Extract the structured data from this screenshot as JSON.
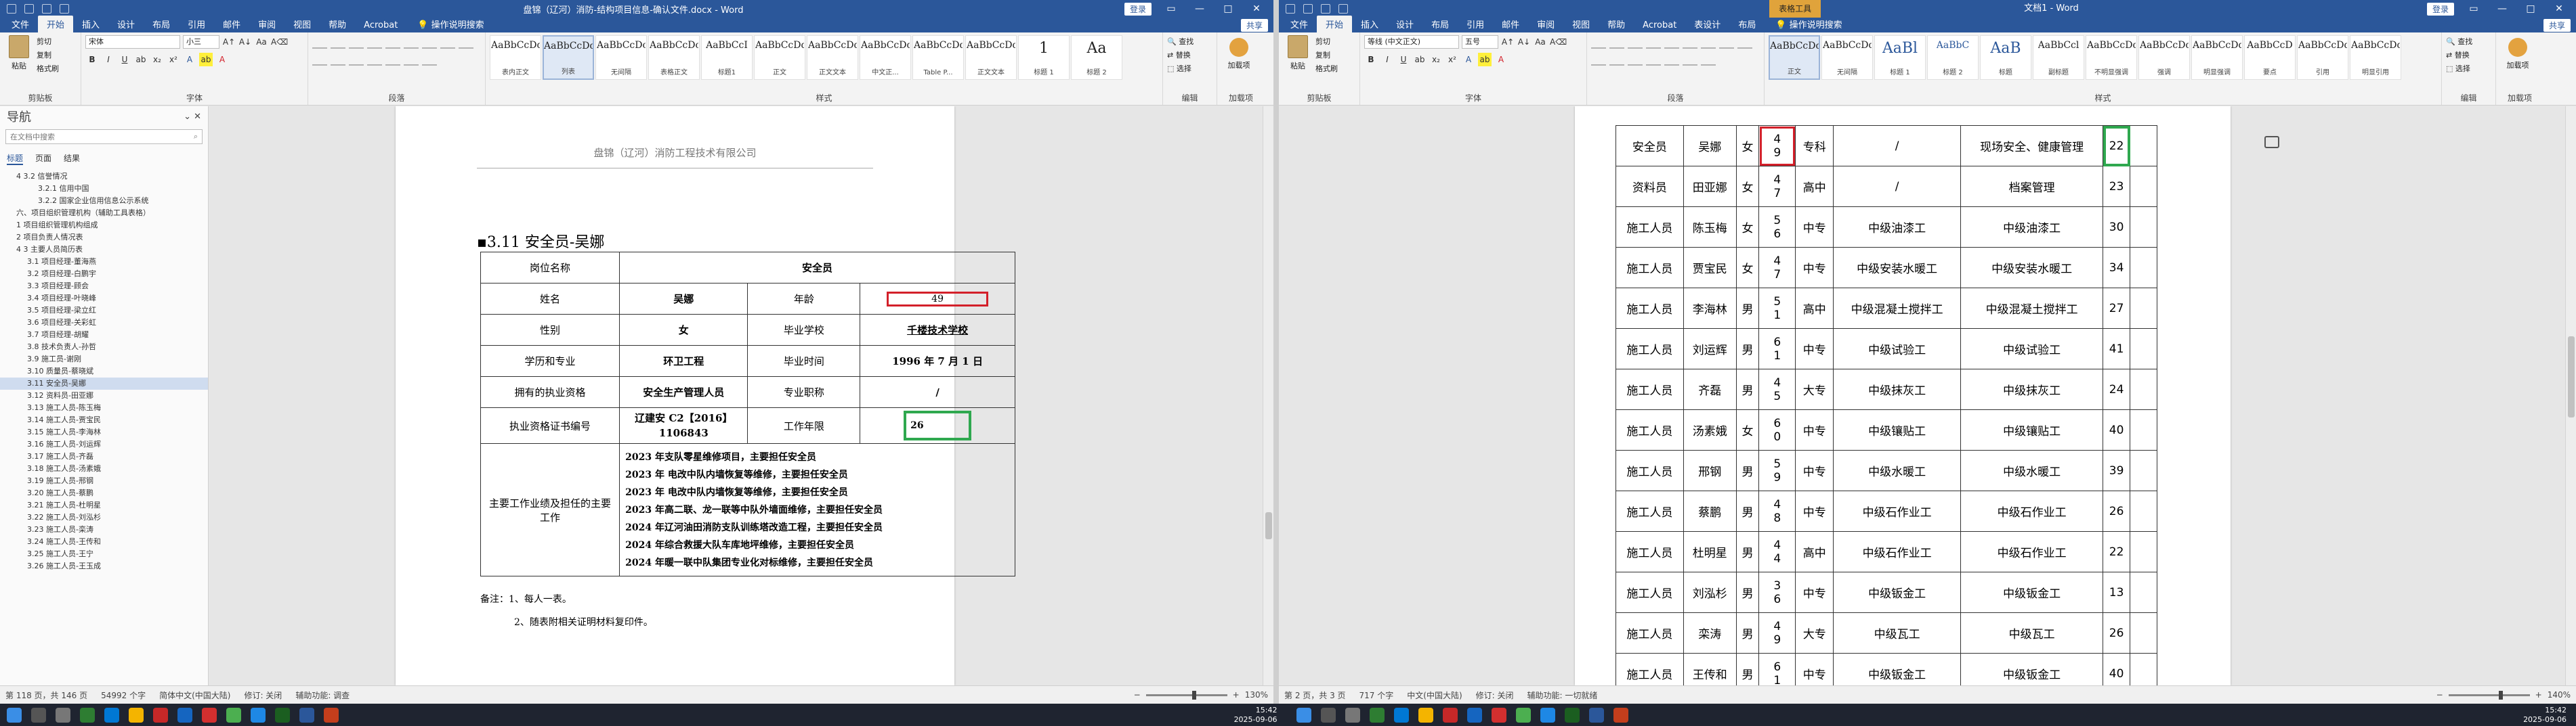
{
  "left": {
    "title": "盘锦（辽河）消防-结构项目信息-确认文件.docx - Word",
    "signin": "登录",
    "share": "共享",
    "tabs": [
      "文件",
      "开始",
      "插入",
      "设计",
      "布局",
      "引用",
      "邮件",
      "审阅",
      "视图",
      "帮助",
      "Acrobat"
    ],
    "tell_me": "操作说明搜索",
    "clipboard": {
      "paste": "粘贴",
      "cut": "剪切",
      "copy": "复制",
      "painter": "格式刷",
      "label": "剪贴板"
    },
    "font": {
      "name": "宋体",
      "size": "小三",
      "label": "字体"
    },
    "paragraph_label": "段落",
    "styles": [
      {
        "sample": "AaBbCcDd",
        "name": "表内正文"
      },
      {
        "sample": "AaBbCcDd",
        "name": "列表"
      },
      {
        "sample": "AaBbCcDc",
        "name": "无间隔"
      },
      {
        "sample": "AaBbCcDc",
        "name": "表格正文"
      },
      {
        "sample": "AaBbCcI",
        "name": "标题1"
      },
      {
        "sample": "AaBbCcDd",
        "name": "正文"
      },
      {
        "sample": "AaBbCcDd",
        "name": "正文文本"
      },
      {
        "sample": "AaBbCcDd",
        "name": "中文正..."
      },
      {
        "sample": "AaBbCcDd",
        "name": "Table P..."
      },
      {
        "sample": "AaBbCcDd",
        "name": "正文文本"
      },
      {
        "sample": "1",
        "name": "标题 1"
      },
      {
        "sample": "Aa",
        "name": "标题 2"
      }
    ],
    "styles_label": "样式",
    "editing": {
      "find": "查找",
      "replace": "替换",
      "select": "选择",
      "label": "编辑"
    },
    "addins": {
      "item": "加载项",
      "label": "加载项"
    },
    "nav": {
      "title": "导航",
      "search_placeholder": "在文档中搜索",
      "tabs": [
        "标题",
        "页面",
        "结果"
      ],
      "items": [
        "4 3.2 信誉情况",
        "3.2.1 信用中国",
        "3.2.2 国家企业信用信息公示系统",
        "六、项目组织管理机构（辅助工具表格）",
        "1 项目组织管理机构组成",
        "2 项目负责人情况表",
        "4 3 主要人员简历表",
        "3.1 项目经理-董海燕",
        "3.2 项目经理-白鹏宇",
        "3.3 项目经理-顾会",
        "3.4 项目经理-叶晓峰",
        "3.5 项目经理-梁立红",
        "3.6 项目经理-关彩虹",
        "3.7 项目经理-胡耀",
        "3.8 技术负责人-孙哲",
        "3.9 施工员-谢刚",
        "3.10 质量员-蔡晓斌",
        "3.11 安全员-吴娜",
        "3.12 资料员-田亚娜",
        "3.13 施工人员-陈玉梅",
        "3.14 施工人员-贾宝民",
        "3.15 施工人员-李海林",
        "3.16 施工人员-刘运辉",
        "3.17 施工人员-齐磊",
        "3.18 施工人员-汤素娥",
        "3.19 施工人员-邢钢",
        "3.20 施工人员-蔡鹏",
        "3.21 施工人员-杜明星",
        "3.22 施工人员-刘泓杉",
        "3.23 施工人员-栾涛",
        "3.24 施工人员-王传和",
        "3.25 施工人员-王宁",
        "3.26 施工人员-王玉成"
      ],
      "selected_index": 17
    },
    "doc": {
      "header": "盘锦（辽河）消防工程技术有限公司",
      "section_title": "3.11 安全员-吴娜",
      "table": {
        "post_label": "岗位名称",
        "post_value": "安全员",
        "name_label": "姓名",
        "name_value": "吴娜",
        "age_label": "年龄",
        "age_value": "49",
        "gender_label": "性别",
        "gender_value": "女",
        "school_label": "毕业学校",
        "school_value": "千楼技术学校",
        "major_label": "学历和专业",
        "major_value": "环卫工程",
        "grad_label": "毕业时间",
        "grad_value": "1996 年 7 月 1 日",
        "qual_label": "拥有的执业资格",
        "qual_value": "安全生产管理人员",
        "title_label": "专业职称",
        "title_value": "/",
        "cert_label": "执业资格证书编号",
        "cert_value_1": "辽建安 C2【2016】",
        "cert_value_2": "1106843",
        "years_label": "工作年限",
        "years_value": "26",
        "works_label": "主要工作业绩及担任的主要工作",
        "works": [
          "2023 年支队零星维修项目，主要担任安全员",
          "2023 年  电改中队内墙恢复等维修，主要担任安全员",
          "2023 年  电改中队内墙恢复等维修，主要担任安全员",
          "2023 年高二联、龙一联等中队外墙面维修，主要担任安全员",
          "2024 年辽河油田消防支队训练塔改造工程，主要担任安全员",
          "2024 年综合救援大队车库地坪维修，主要担任安全员",
          "2024 年暖一联中队集团专业化对标维修，主要担任安全员"
        ]
      },
      "note_1": "备注：1、每人一表。",
      "note_2": "2、随表附相关证明材料复印件。"
    },
    "status": {
      "page": "第 118 页，共 146 页",
      "words": "54992 个字",
      "lang": "简体中文(中国大陆)",
      "track": "修订: 关闭",
      "access": "辅助功能: 调查",
      "zoom": "130%"
    }
  },
  "right": {
    "title": "文档1 - Word",
    "context_tab": "表格工具",
    "signin": "登录",
    "share": "共享",
    "tabs": [
      "文件",
      "开始",
      "插入",
      "设计",
      "布局",
      "引用",
      "邮件",
      "审阅",
      "视图",
      "帮助",
      "Acrobat",
      "表设计",
      "布局"
    ],
    "tell_me": "操作说明搜索",
    "clipboard": {
      "paste": "粘贴",
      "cut": "剪切",
      "copy": "复制",
      "painter": "格式刷",
      "label": "剪贴板"
    },
    "font": {
      "name": "等线 (中文正文)",
      "size": "五号",
      "label": "字体"
    },
    "paragraph_label": "段落",
    "styles": [
      {
        "sample": "AaBbCcDd",
        "name": "正文"
      },
      {
        "sample": "AaBbCcDd",
        "name": "无间隔"
      },
      {
        "sample": "AaBl",
        "name": "标题 1"
      },
      {
        "sample": "AaBbC",
        "name": "标题 2"
      },
      {
        "sample": "AaB",
        "name": "标题"
      },
      {
        "sample": "AaBbCcl",
        "name": "副标题"
      },
      {
        "sample": "AaBbCcDd",
        "name": "不明显强调"
      },
      {
        "sample": "AaBbCcDd",
        "name": "强调"
      },
      {
        "sample": "AaBbCcDd",
        "name": "明显强调"
      },
      {
        "sample": "AaBbCcD",
        "name": "要点"
      },
      {
        "sample": "AaBbCcDd",
        "name": "引用"
      },
      {
        "sample": "AaBbCcDd",
        "name": "明显引用"
      }
    ],
    "styles_label": "样式",
    "editing": {
      "find": "查找",
      "replace": "替换",
      "select": "选择",
      "label": "编辑"
    },
    "addins": {
      "item": "加载项",
      "label": "加载项"
    },
    "table": {
      "rows": [
        [
          "安全员",
          "吴娜",
          "女",
          "4\n9",
          "专科",
          "/",
          "现场安全、健康管理",
          "22"
        ],
        [
          "资料员",
          "田亚娜",
          "女",
          "4\n7",
          "高中",
          "/",
          "档案管理",
          "23"
        ],
        [
          "施工人员",
          "陈玉梅",
          "女",
          "5\n6",
          "中专",
          "中级油漆工",
          "中级油漆工",
          "30"
        ],
        [
          "施工人员",
          "贾宝民",
          "女",
          "4\n7",
          "中专",
          "中级安装水暖工",
          "中级安装水暖工",
          "34"
        ],
        [
          "施工人员",
          "李海林",
          "男",
          "5\n1",
          "高中",
          "中级混凝土搅拌工",
          "中级混凝土搅拌工",
          "27"
        ],
        [
          "施工人员",
          "刘运辉",
          "男",
          "6\n1",
          "中专",
          "中级试验工",
          "中级试验工",
          "41"
        ],
        [
          "施工人员",
          "齐磊",
          "男",
          "4\n5",
          "大专",
          "中级抹灰工",
          "中级抹灰工",
          "24"
        ],
        [
          "施工人员",
          "汤素娥",
          "女",
          "6\n0",
          "中专",
          "中级镶贴工",
          "中级镶贴工",
          "40"
        ],
        [
          "施工人员",
          "邢钢",
          "男",
          "5\n9",
          "中专",
          "中级水暖工",
          "中级水暖工",
          "39"
        ],
        [
          "施工人员",
          "蔡鹏",
          "男",
          "4\n8",
          "中专",
          "中级石作业工",
          "中级石作业工",
          "26"
        ],
        [
          "施工人员",
          "杜明星",
          "男",
          "4\n4",
          "高中",
          "中级石作业工",
          "中级石作业工",
          "22"
        ],
        [
          "施工人员",
          "刘泓杉",
          "男",
          "3\n6",
          "中专",
          "中级钣金工",
          "中级钣金工",
          "13"
        ],
        [
          "施工人员",
          "栾涛",
          "男",
          "4\n9",
          "大专",
          "中级瓦工",
          "中级瓦工",
          "26"
        ],
        [
          "施工人员",
          "王传和",
          "男",
          "6\n1",
          "中专",
          "中级钣金工",
          "中级钣金工",
          "40"
        ]
      ]
    },
    "status": {
      "page": "第 2 页，共 3 页",
      "words": "717 个字",
      "lang": "中文(中国大陆)",
      "track": "修订: 关闭",
      "access": "辅助功能: 一切就绪",
      "zoom": "140%"
    }
  },
  "clock": {
    "time": "15:42",
    "date": "2025-09-06"
  }
}
